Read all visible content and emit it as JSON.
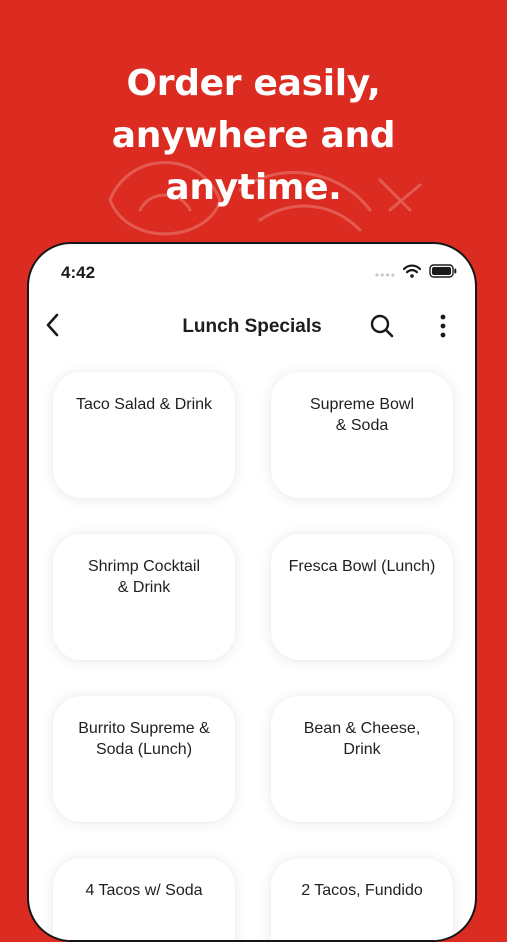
{
  "promo": {
    "line1": "Order easily,",
    "line2": "anywhere and",
    "line3": "anytime."
  },
  "colors": {
    "background": "#dc2b20",
    "text_on_bg": "#ffffff",
    "card": "#ffffff",
    "text": "#1f1f1f"
  },
  "status_bar": {
    "time": "4:42",
    "icons": [
      "wifi-icon",
      "battery-icon"
    ]
  },
  "nav": {
    "title": "Lunch Specials",
    "back_icon": "chevron-left-icon",
    "search_icon": "search-icon",
    "more_icon": "more-vertical-icon"
  },
  "items": [
    {
      "label": "Taco Salad & Drink"
    },
    {
      "label": "Supreme Bowl\n& Soda"
    },
    {
      "label": "Shrimp Cocktail\n& Drink"
    },
    {
      "label": "Fresca Bowl (Lunch)"
    },
    {
      "label": "Burrito Supreme &\nSoda (Lunch)"
    },
    {
      "label": "Bean & Cheese,\nDrink"
    },
    {
      "label": "4 Tacos w/ Soda"
    },
    {
      "label": "2 Tacos, Fundido"
    }
  ]
}
